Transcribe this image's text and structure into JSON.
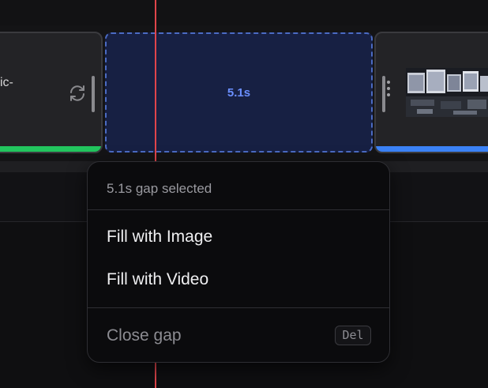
{
  "timeline": {
    "left_clip": {
      "name_fragment": "ic-",
      "bar_color": "#22c55e",
      "icon": "loop-icon"
    },
    "gap": {
      "label": "5.1s",
      "border_color": "#4b6bc4",
      "fill_color": "#172043"
    },
    "right_clip": {
      "bar_color": "#3b82f6",
      "icon": "grip-icon"
    },
    "playhead_color": "#e0454b"
  },
  "context_menu": {
    "header": "5.1s gap selected",
    "items": [
      {
        "label": "Fill with Image"
      },
      {
        "label": "Fill with Video"
      }
    ],
    "close": {
      "label": "Close gap",
      "shortcut": "Del"
    }
  }
}
